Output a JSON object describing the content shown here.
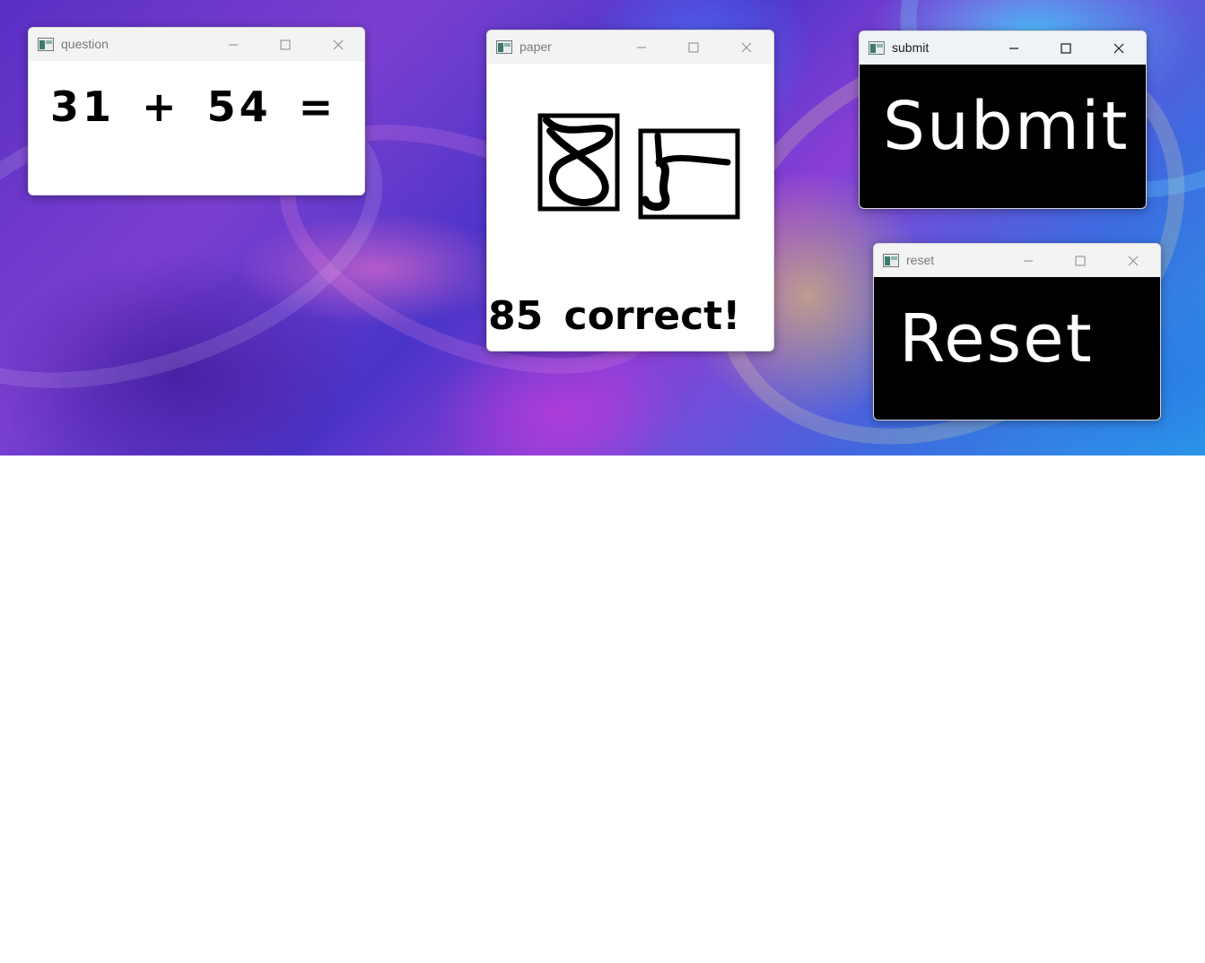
{
  "windows": {
    "question": {
      "title": "question",
      "content_text": "31 + 54 = ?"
    },
    "paper": {
      "title": "paper",
      "result_text": "85 correct!"
    },
    "submit": {
      "title": "submit",
      "button_text": "Submit"
    },
    "reset": {
      "title": "reset",
      "button_text": "Reset"
    }
  },
  "icons": {
    "app": "app-window-icon",
    "minimize": "minimize-icon",
    "maximize": "maximize-icon",
    "close": "close-icon"
  },
  "colors": {
    "canvas_dark": "#000000",
    "canvas_light": "#ffffff",
    "ink": "#000000"
  }
}
